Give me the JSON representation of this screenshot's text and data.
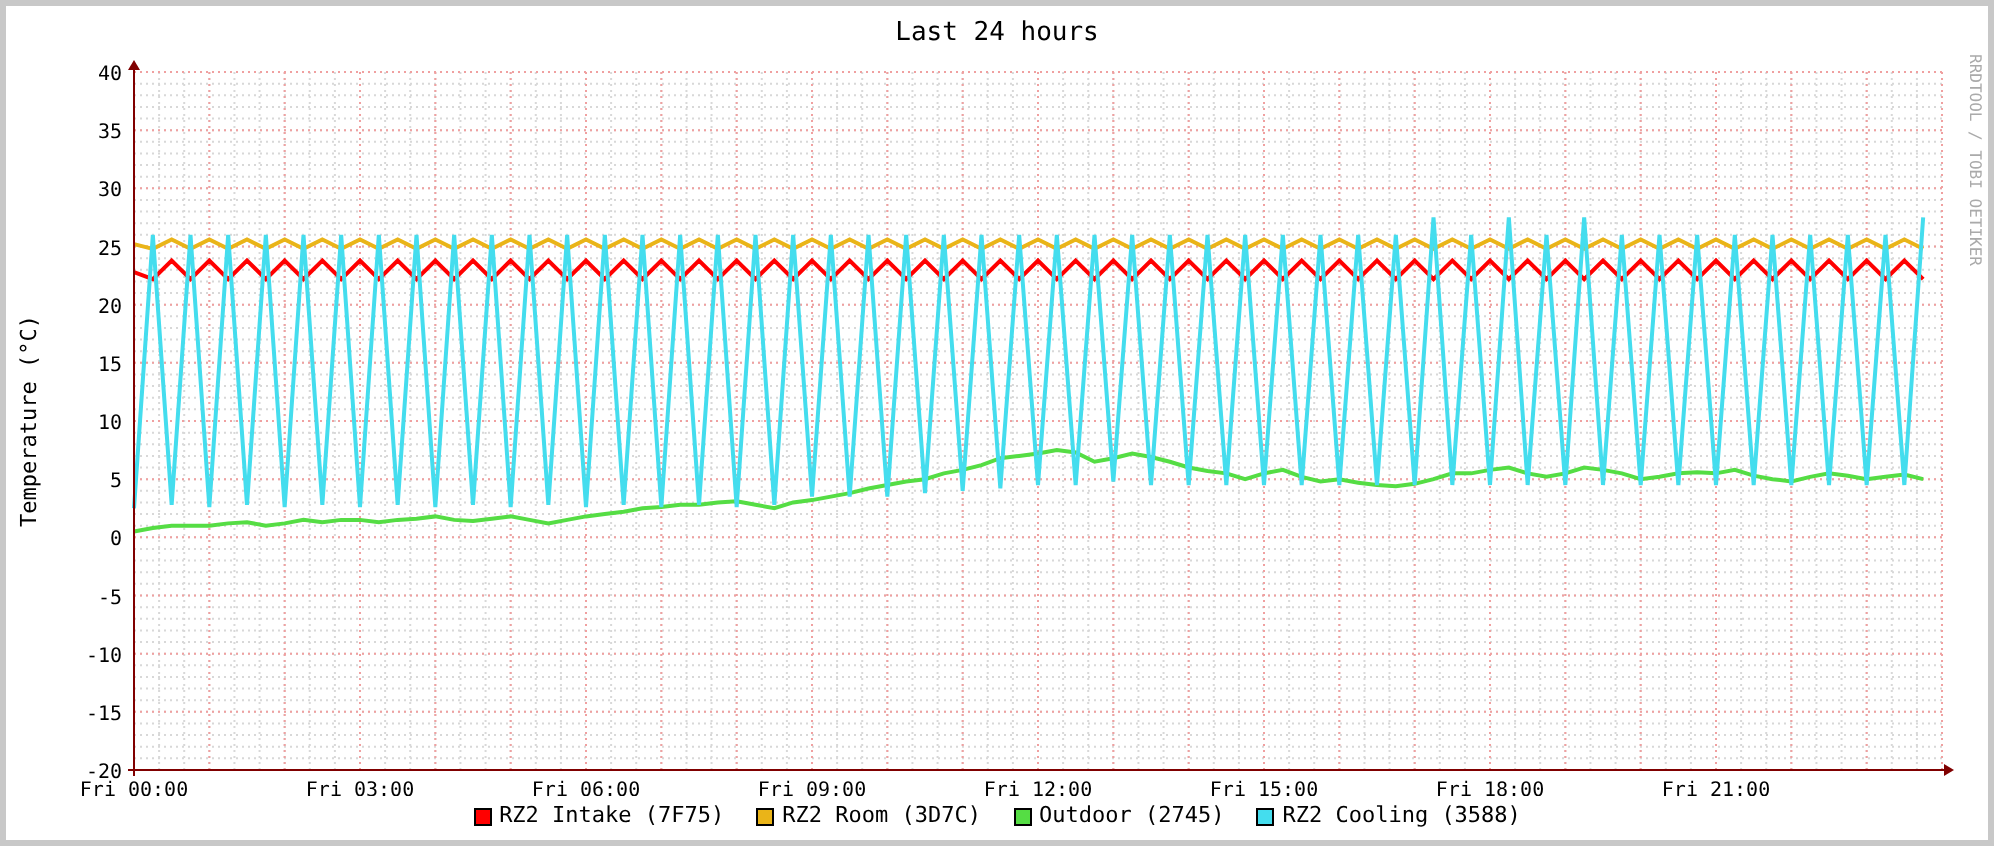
{
  "chart_data": {
    "type": "line",
    "title": "Last 24 hours",
    "ylabel": "Temperature (°C)",
    "categories": [
      "Fri 00:00",
      null,
      null,
      null,
      null,
      null,
      null,
      null,
      null,
      null,
      null,
      null,
      "Fri 03:00",
      null,
      null,
      null,
      null,
      null,
      null,
      null,
      null,
      null,
      null,
      null,
      "Fri 06:00",
      null,
      null,
      null,
      null,
      null,
      null,
      null,
      null,
      null,
      null,
      null,
      "Fri 09:00",
      null,
      null,
      null,
      null,
      null,
      null,
      null,
      null,
      null,
      null,
      null,
      "Fri 12:00",
      null,
      null,
      null,
      null,
      null,
      null,
      null,
      null,
      null,
      null,
      null,
      "Fri 15:00",
      null,
      null,
      null,
      null,
      null,
      null,
      null,
      null,
      null,
      null,
      null,
      "Fri 18:00",
      null,
      null,
      null,
      null,
      null,
      null,
      null,
      null,
      null,
      null,
      null,
      "Fri 21:00",
      null,
      null,
      null,
      null,
      null,
      null,
      null,
      null,
      null,
      null,
      null
    ],
    "ylim": [
      -20,
      40
    ],
    "grid": true,
    "yticks": [
      -20,
      -15,
      -10,
      -5,
      0,
      5,
      10,
      15,
      20,
      25,
      30,
      35,
      40
    ],
    "series": [
      {
        "name": "RZ2 Intake (7F75)",
        "color": "#ff0000",
        "values": [
          22.8,
          22.2,
          23.8,
          22.2,
          23.8,
          22.2,
          23.8,
          22.2,
          23.8,
          22.2,
          23.8,
          22.2,
          23.8,
          22.2,
          23.8,
          22.2,
          23.8,
          22.2,
          23.8,
          22.2,
          23.8,
          22.2,
          23.8,
          22.2,
          23.8,
          22.2,
          23.8,
          22.2,
          23.8,
          22.2,
          23.8,
          22.2,
          23.8,
          22.2,
          23.8,
          22.2,
          23.8,
          22.2,
          23.8,
          22.2,
          23.8,
          22.2,
          23.8,
          22.2,
          23.8,
          22.2,
          23.8,
          22.2,
          23.8,
          22.2,
          23.8,
          22.2,
          23.8,
          22.2,
          23.8,
          22.2,
          23.8,
          22.2,
          23.8,
          22.2,
          23.8,
          22.2,
          23.8,
          22.2,
          23.8,
          22.2,
          23.8,
          22.2,
          23.8,
          22.2,
          23.8,
          22.2,
          23.8,
          22.2,
          23.8,
          22.2,
          23.8,
          22.2,
          23.8,
          22.2,
          23.8,
          22.2,
          23.8,
          22.2,
          23.8,
          22.2,
          23.8,
          22.2,
          23.8,
          22.2,
          23.8,
          22.2,
          23.8,
          22.2,
          23.8,
          22.2
        ]
      },
      {
        "name": "RZ2 Room (3D7C)",
        "color": "#eab418",
        "values": [
          25.2,
          24.8,
          25.6,
          24.8,
          25.6,
          24.8,
          25.6,
          24.8,
          25.6,
          24.8,
          25.6,
          24.8,
          25.6,
          24.8,
          25.6,
          24.8,
          25.6,
          24.8,
          25.6,
          24.8,
          25.6,
          24.8,
          25.6,
          24.8,
          25.6,
          24.8,
          25.6,
          24.8,
          25.6,
          24.8,
          25.6,
          24.8,
          25.6,
          24.8,
          25.6,
          24.8,
          25.6,
          24.8,
          25.6,
          24.8,
          25.6,
          24.8,
          25.6,
          24.8,
          25.6,
          24.8,
          25.6,
          24.8,
          25.6,
          24.8,
          25.6,
          24.8,
          25.6,
          24.8,
          25.6,
          24.8,
          25.6,
          24.8,
          25.6,
          24.8,
          25.6,
          24.8,
          25.6,
          24.8,
          25.6,
          24.8,
          25.6,
          24.8,
          25.6,
          24.8,
          25.6,
          24.8,
          25.6,
          24.8,
          25.6,
          24.8,
          25.6,
          24.8,
          25.6,
          24.8,
          25.6,
          24.8,
          25.6,
          24.8,
          25.6,
          24.8,
          25.6,
          24.8,
          25.6,
          24.8,
          25.6,
          24.8,
          25.6,
          24.8,
          25.6,
          24.8
        ]
      },
      {
        "name": "Outdoor (2745)",
        "color": "#55dd44",
        "values": [
          0.5,
          0.8,
          1,
          1,
          1,
          1.2,
          1.3,
          1,
          1.2,
          1.5,
          1.3,
          1.5,
          1.5,
          1.3,
          1.5,
          1.6,
          1.8,
          1.5,
          1.4,
          1.6,
          1.8,
          1.5,
          1.2,
          1.5,
          1.8,
          2,
          2.2,
          2.5,
          2.6,
          2.8,
          2.8,
          3,
          3.1,
          2.8,
          2.5,
          3,
          3.2,
          3.5,
          3.8,
          4.2,
          4.5,
          4.8,
          5,
          5.5,
          5.8,
          6.2,
          6.8,
          7,
          7.2,
          7.5,
          7.3,
          6.5,
          6.8,
          7.2,
          6.9,
          6.5,
          6,
          5.7,
          5.5,
          5,
          5.5,
          5.8,
          5.2,
          4.8,
          5,
          4.7,
          4.5,
          4.4,
          4.6,
          5,
          5.5,
          5.5,
          5.8,
          6,
          5.5,
          5.2,
          5.5,
          6,
          5.8,
          5.5,
          5,
          5.2,
          5.5,
          5.6,
          5.5,
          5.8,
          5.3,
          5,
          4.8,
          5.2,
          5.5,
          5.3,
          5,
          5.2,
          5.4,
          5
        ]
      },
      {
        "name": "RZ2 Cooling (3588)",
        "color": "#44ddee",
        "values": [
          2.5,
          26,
          2.8,
          26,
          2.6,
          26,
          2.8,
          26,
          2.6,
          26,
          2.8,
          26,
          2.6,
          26,
          2.8,
          26,
          2.6,
          26,
          2.8,
          26,
          2.6,
          26,
          2.8,
          26,
          2.6,
          26,
          2.8,
          26,
          2.6,
          26,
          2.8,
          26,
          2.6,
          26,
          2.8,
          26,
          3.5,
          26,
          3.5,
          26,
          3.5,
          26,
          3.8,
          26,
          4,
          26,
          4.2,
          26,
          4.5,
          26,
          4.5,
          26,
          4.8,
          26,
          4.5,
          26,
          4.5,
          26,
          4.5,
          26,
          4.5,
          26,
          4.5,
          26,
          4.5,
          26,
          4.5,
          26,
          4.5,
          27.5,
          4.5,
          26,
          4.5,
          27.5,
          4.5,
          26,
          4.5,
          27.5,
          4.5,
          26,
          4.5,
          26,
          4.5,
          26,
          4.5,
          26,
          4.5,
          26,
          4.5,
          26,
          4.5,
          26,
          4.5,
          26,
          4.5,
          27.5
        ]
      }
    ]
  },
  "credit": "RRDTOOL / TOBI OETIKER"
}
